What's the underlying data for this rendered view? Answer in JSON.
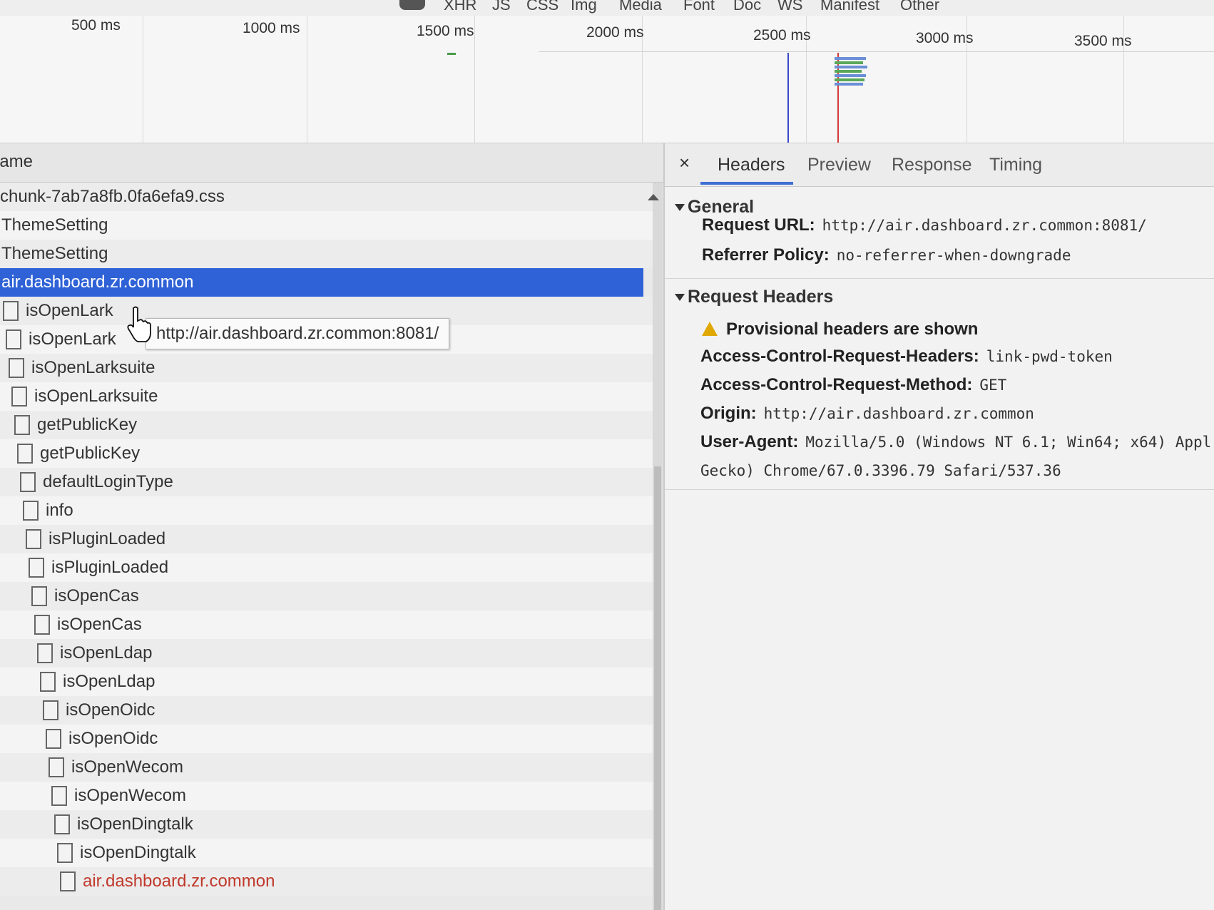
{
  "filter_bar": {
    "chips": [
      "XHR",
      "JS",
      "CSS",
      "Img",
      "Media",
      "Font",
      "Doc",
      "WS",
      "Manifest",
      "Other"
    ]
  },
  "overview": {
    "ticks": [
      "500 ms",
      "1000 ms",
      "1500 ms",
      "2000 ms",
      "2500 ms",
      "3000 ms",
      "3500 ms"
    ],
    "colors": {
      "dom_content_loaded": "#3b49c8",
      "load": "#d23b3b"
    }
  },
  "request_list": {
    "column_header": "Name",
    "rows": [
      {
        "name": "chunk-7ab7a8fb.0fa6efa9.css",
        "selected": false
      },
      {
        "name": "ThemeSetting",
        "selected": false
      },
      {
        "name": "ThemeSetting",
        "selected": false
      },
      {
        "name": "air.dashboard.zr.common",
        "selected": true
      },
      {
        "name": "isOpenLark",
        "selected": false
      },
      {
        "name": "isOpenLark",
        "selected": false
      },
      {
        "name": "isOpenLarksuite",
        "selected": false
      },
      {
        "name": "isOpenLarksuite",
        "selected": false
      },
      {
        "name": "getPublicKey",
        "selected": false
      },
      {
        "name": "getPublicKey",
        "selected": false
      },
      {
        "name": "defaultLoginType",
        "selected": false
      },
      {
        "name": "info",
        "selected": false
      },
      {
        "name": "isPluginLoaded",
        "selected": false
      },
      {
        "name": "isPluginLoaded",
        "selected": false
      },
      {
        "name": "isOpenCas",
        "selected": false
      },
      {
        "name": "isOpenCas",
        "selected": false
      },
      {
        "name": "isOpenLdap",
        "selected": false
      },
      {
        "name": "isOpenLdap",
        "selected": false
      },
      {
        "name": "isOpenOidc",
        "selected": false
      },
      {
        "name": "isOpenOidc",
        "selected": false
      },
      {
        "name": "isOpenWecom",
        "selected": false
      },
      {
        "name": "isOpenWecom",
        "selected": false
      },
      {
        "name": "isOpenDingtalk",
        "selected": false
      },
      {
        "name": "isOpenDingtalk",
        "selected": false
      },
      {
        "name": "air.dashboard.zr.common",
        "selected": false,
        "partial": true
      }
    ],
    "tooltip": "http://air.dashboard.zr.common:8081/",
    "selected_color": "#2f62d6"
  },
  "detail": {
    "close_label": "×",
    "tabs": [
      "Headers",
      "Preview",
      "Response",
      "Timing"
    ],
    "active_tab": "Headers",
    "general": {
      "title": "General",
      "request_url_key": "Request URL:",
      "request_url_val": "http://air.dashboard.zr.common:8081/",
      "referrer_key": "Referrer Policy:",
      "referrer_val": "no-referrer-when-downgrade"
    },
    "request_headers": {
      "title": "Request Headers",
      "warning": "Provisional headers are shown",
      "acrh_key": "Access-Control-Request-Headers:",
      "acrh_val": "link-pwd-token",
      "acrm_key": "Access-Control-Request-Method:",
      "acrm_val": "GET",
      "origin_key": "Origin:",
      "origin_val": "http://air.dashboard.zr.common",
      "ua_key": "User-Agent:",
      "ua_val_line1": "Mozilla/5.0 (Windows NT 6.1; Win64; x64) Appl",
      "ua_val_line2": "Gecko) Chrome/67.0.3396.79 Safari/537.36"
    }
  }
}
